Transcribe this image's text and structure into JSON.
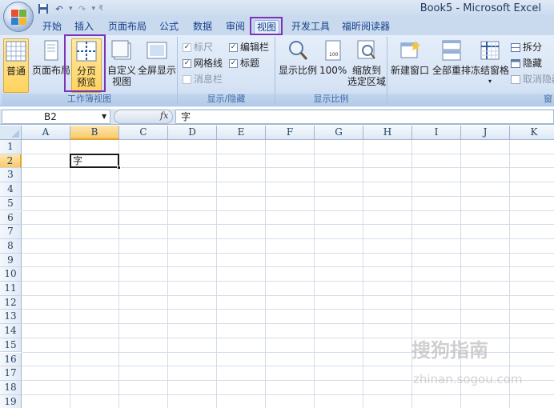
{
  "window": {
    "title": "Book5 - Microsoft Excel"
  },
  "tabs": [
    {
      "label": "开始"
    },
    {
      "label": "插入"
    },
    {
      "label": "页面布局"
    },
    {
      "label": "公式"
    },
    {
      "label": "数据"
    },
    {
      "label": "审阅"
    },
    {
      "label": "视图"
    },
    {
      "label": "开发工具"
    },
    {
      "label": "福昕阅读器"
    }
  ],
  "ribbon": {
    "workbook_views": {
      "label": "工作簿视图",
      "normal": "普通",
      "page_layout": "页面布局",
      "page_break_line1": "分页",
      "page_break_line2": "预览",
      "custom_line1": "自定义",
      "custom_line2": "视图",
      "fullscreen": "全屏显示"
    },
    "show_hide": {
      "label": "显示/隐藏",
      "ruler": "标尺",
      "formula_bar": "编辑栏",
      "gridlines": "网格线",
      "headings": "标题",
      "message_bar": "消息栏"
    },
    "zoom": {
      "label": "显示比例",
      "zoom": "显示比例",
      "hundred": "100%",
      "fit_line1": "缩放到",
      "fit_line2": "选定区域"
    },
    "window": {
      "label": "窗",
      "new_window": "新建窗口",
      "arrange_all": "全部重排",
      "freeze": "冻结窗格",
      "split": "拆分",
      "hide": "隐藏",
      "unhide": "取消隐藏"
    }
  },
  "formula_bar": {
    "name_box": "B2",
    "fx": "fx",
    "value": "字"
  },
  "grid": {
    "columns": [
      "A",
      "B",
      "C",
      "D",
      "E",
      "F",
      "G",
      "H",
      "I",
      "J",
      "K"
    ],
    "rows": [
      "1",
      "2",
      "3",
      "4",
      "5",
      "6",
      "7",
      "8",
      "9",
      "10",
      "11",
      "12",
      "13",
      "14",
      "15",
      "16",
      "17",
      "18",
      "19"
    ],
    "active_cell": "B2",
    "active_value": "字"
  },
  "watermark": {
    "main": "搜狗指南",
    "sub": "zhinan.sogou.com"
  },
  "colors": {
    "highlight": "#7d33b5",
    "selected_header": "#f9c969"
  }
}
